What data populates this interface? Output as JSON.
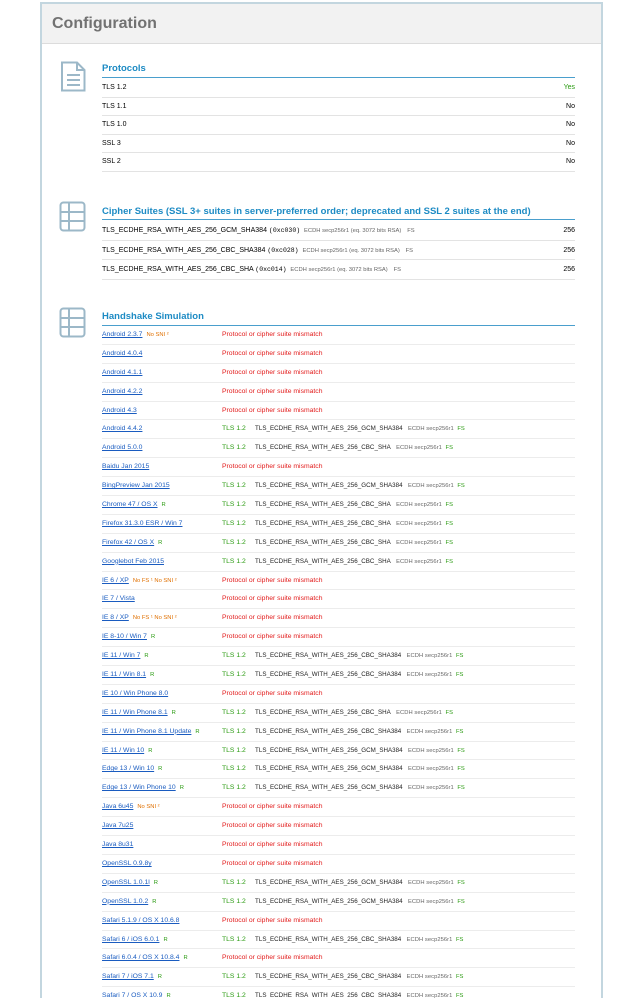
{
  "header": {
    "title": "Configuration"
  },
  "protocols": {
    "title": "Protocols",
    "rows": [
      {
        "name": "TLS 1.2",
        "value": "Yes"
      },
      {
        "name": "TLS 1.1",
        "value": "No"
      },
      {
        "name": "TLS 1.0",
        "value": "No"
      },
      {
        "name": "SSL 3",
        "value": "No"
      },
      {
        "name": "SSL 2",
        "value": "No"
      }
    ]
  },
  "ciphers": {
    "title": "Cipher Suites (SSL 3+ suites in server-preferred order; deprecated and SSL 2 suites at the end)",
    "rows": [
      {
        "suite": "TLS_ECDHE_RSA_WITH_AES_256_GCM_SHA384",
        "code": "(0xc030)",
        "kx": "ECDH secp256r1 (eq. 3072 bits RSA)",
        "fs": "FS",
        "bits": "256"
      },
      {
        "suite": "TLS_ECDHE_RSA_WITH_AES_256_CBC_SHA384",
        "code": "(0xc028)",
        "kx": "ECDH secp256r1 (eq. 3072 bits RSA)",
        "fs": "FS",
        "bits": "256"
      },
      {
        "suite": "TLS_ECDHE_RSA_WITH_AES_256_CBC_SHA",
        "code": "(0xc014)",
        "kx": "ECDH secp256r1 (eq. 3072 bits RSA)",
        "fs": "FS",
        "bits": "256"
      }
    ]
  },
  "handshake": {
    "title": "Handshake Simulation",
    "rows": [
      {
        "client": "Android 2.3.7",
        "flags": "No SNI ²",
        "r": "",
        "result": "Protocol or cipher suite mismatch"
      },
      {
        "client": "Android 4.0.4",
        "flags": "",
        "r": "",
        "result": "Protocol or cipher suite mismatch"
      },
      {
        "client": "Android 4.1.1",
        "flags": "",
        "r": "",
        "result": "Protocol or cipher suite mismatch"
      },
      {
        "client": "Android 4.2.2",
        "flags": "",
        "r": "",
        "result": "Protocol or cipher suite mismatch"
      },
      {
        "client": "Android 4.3",
        "flags": "",
        "r": "",
        "result": "Protocol or cipher suite mismatch"
      },
      {
        "client": "Android 4.4.2",
        "flags": "",
        "r": "",
        "tls": "TLS 1.2",
        "suite": "TLS_ECDHE_RSA_WITH_AES_256_GCM_SHA384",
        "ecdh": "ECDH secp256r1",
        "fs": "FS"
      },
      {
        "client": "Android 5.0.0",
        "flags": "",
        "r": "",
        "tls": "TLS 1.2",
        "suite": "TLS_ECDHE_RSA_WITH_AES_256_CBC_SHA",
        "ecdh": "ECDH secp256r1",
        "fs": "FS"
      },
      {
        "client": "Baidu Jan 2015",
        "flags": "",
        "r": "",
        "result": "Protocol or cipher suite mismatch"
      },
      {
        "client": "BingPreview Jan 2015",
        "flags": "",
        "r": "",
        "tls": "TLS 1.2",
        "suite": "TLS_ECDHE_RSA_WITH_AES_256_GCM_SHA384",
        "ecdh": "ECDH secp256r1",
        "fs": "FS"
      },
      {
        "client": "Chrome 47 / OS X",
        "flags": "",
        "r": "R",
        "tls": "TLS 1.2",
        "suite": "TLS_ECDHE_RSA_WITH_AES_256_CBC_SHA",
        "ecdh": "ECDH secp256r1",
        "fs": "FS"
      },
      {
        "client": "Firefox 31.3.0 ESR / Win 7",
        "flags": "",
        "r": "",
        "tls": "TLS 1.2",
        "suite": "TLS_ECDHE_RSA_WITH_AES_256_CBC_SHA",
        "ecdh": "ECDH secp256r1",
        "fs": "FS"
      },
      {
        "client": "Firefox 42 / OS X",
        "flags": "",
        "r": "R",
        "tls": "TLS 1.2",
        "suite": "TLS_ECDHE_RSA_WITH_AES_256_CBC_SHA",
        "ecdh": "ECDH secp256r1",
        "fs": "FS"
      },
      {
        "client": "Googlebot Feb 2015",
        "flags": "",
        "r": "",
        "tls": "TLS 1.2",
        "suite": "TLS_ECDHE_RSA_WITH_AES_256_CBC_SHA",
        "ecdh": "ECDH secp256r1",
        "fs": "FS"
      },
      {
        "client": "IE 6 / XP",
        "flags": "No FS ¹   No SNI ²",
        "r": "",
        "result": "Protocol or cipher suite mismatch"
      },
      {
        "client": "IE 7 / Vista",
        "flags": "",
        "r": "",
        "result": "Protocol or cipher suite mismatch"
      },
      {
        "client": "IE 8 / XP",
        "flags": "No FS ¹   No SNI ²",
        "r": "",
        "result": "Protocol or cipher suite mismatch"
      },
      {
        "client": "IE 8-10 / Win 7",
        "flags": "",
        "r": "R",
        "result": "Protocol or cipher suite mismatch"
      },
      {
        "client": "IE 11 / Win 7",
        "flags": "",
        "r": "R",
        "tls": "TLS 1.2",
        "suite": "TLS_ECDHE_RSA_WITH_AES_256_CBC_SHA384",
        "ecdh": "ECDH secp256r1",
        "fs": "FS"
      },
      {
        "client": "IE 11 / Win 8.1",
        "flags": "",
        "r": "R",
        "tls": "TLS 1.2",
        "suite": "TLS_ECDHE_RSA_WITH_AES_256_CBC_SHA384",
        "ecdh": "ECDH secp256r1",
        "fs": "FS"
      },
      {
        "client": "IE 10 / Win Phone 8.0",
        "flags": "",
        "r": "",
        "result": "Protocol or cipher suite mismatch"
      },
      {
        "client": "IE 11 / Win Phone 8.1",
        "flags": "",
        "r": "R",
        "tls": "TLS 1.2",
        "suite": "TLS_ECDHE_RSA_WITH_AES_256_CBC_SHA",
        "ecdh": "ECDH secp256r1",
        "fs": "FS"
      },
      {
        "client": "IE 11 / Win Phone 8.1 Update",
        "flags": "",
        "r": "R",
        "tls": "TLS 1.2",
        "suite": "TLS_ECDHE_RSA_WITH_AES_256_CBC_SHA384",
        "ecdh": "ECDH secp256r1",
        "fs": "FS"
      },
      {
        "client": "IE 11 / Win 10",
        "flags": "",
        "r": "R",
        "tls": "TLS 1.2",
        "suite": "TLS_ECDHE_RSA_WITH_AES_256_GCM_SHA384",
        "ecdh": "ECDH secp256r1",
        "fs": "FS"
      },
      {
        "client": "Edge 13 / Win 10",
        "flags": "",
        "r": "R",
        "tls": "TLS 1.2",
        "suite": "TLS_ECDHE_RSA_WITH_AES_256_GCM_SHA384",
        "ecdh": "ECDH secp256r1",
        "fs": "FS"
      },
      {
        "client": "Edge 13 / Win Phone 10",
        "flags": "",
        "r": "R",
        "tls": "TLS 1.2",
        "suite": "TLS_ECDHE_RSA_WITH_AES_256_GCM_SHA384",
        "ecdh": "ECDH secp256r1",
        "fs": "FS"
      },
      {
        "client": "Java 6u45",
        "flags": "No SNI ²",
        "r": "",
        "result": "Protocol or cipher suite mismatch"
      },
      {
        "client": "Java 7u25",
        "flags": "",
        "r": "",
        "result": "Protocol or cipher suite mismatch"
      },
      {
        "client": "Java 8u31",
        "flags": "",
        "r": "",
        "result": "Protocol or cipher suite mismatch"
      },
      {
        "client": "OpenSSL 0.9.8y",
        "flags": "",
        "r": "",
        "result": "Protocol or cipher suite mismatch"
      },
      {
        "client": "OpenSSL 1.0.1l",
        "flags": "",
        "r": "R",
        "tls": "TLS 1.2",
        "suite": "TLS_ECDHE_RSA_WITH_AES_256_GCM_SHA384",
        "ecdh": "ECDH secp256r1",
        "fs": "FS"
      },
      {
        "client": "OpenSSL 1.0.2",
        "flags": "",
        "r": "R",
        "tls": "TLS 1.2",
        "suite": "TLS_ECDHE_RSA_WITH_AES_256_GCM_SHA384",
        "ecdh": "ECDH secp256r1",
        "fs": "FS"
      },
      {
        "client": "Safari 5.1.9 / OS X 10.6.8",
        "flags": "",
        "r": "",
        "result": "Protocol or cipher suite mismatch"
      },
      {
        "client": "Safari 6 / iOS 6.0.1",
        "flags": "",
        "r": "R",
        "tls": "TLS 1.2",
        "suite": "TLS_ECDHE_RSA_WITH_AES_256_CBC_SHA384",
        "ecdh": "ECDH secp256r1",
        "fs": "FS"
      },
      {
        "client": "Safari 6.0.4 / OS X 10.8.4",
        "flags": "",
        "r": "R",
        "result": "Protocol or cipher suite mismatch"
      },
      {
        "client": "Safari 7 / iOS 7.1",
        "flags": "",
        "r": "R",
        "tls": "TLS 1.2",
        "suite": "TLS_ECDHE_RSA_WITH_AES_256_CBC_SHA384",
        "ecdh": "ECDH secp256r1",
        "fs": "FS"
      },
      {
        "client": "Safari 7 / OS X 10.9",
        "flags": "",
        "r": "R",
        "tls": "TLS 1.2",
        "suite": "TLS_ECDHE_RSA_WITH_AES_256_CBC_SHA384",
        "ecdh": "ECDH secp256r1",
        "fs": "FS"
      }
    ]
  },
  "icons": {
    "protocols": "document-icon",
    "ciphers": "list-icon",
    "handshake": "list-icon"
  },
  "colors": {
    "accent": "#1d8bc4",
    "ok": "#2b9b12",
    "error": "#e21b1b",
    "warning": "#e07000",
    "link": "#1a5cc0"
  }
}
